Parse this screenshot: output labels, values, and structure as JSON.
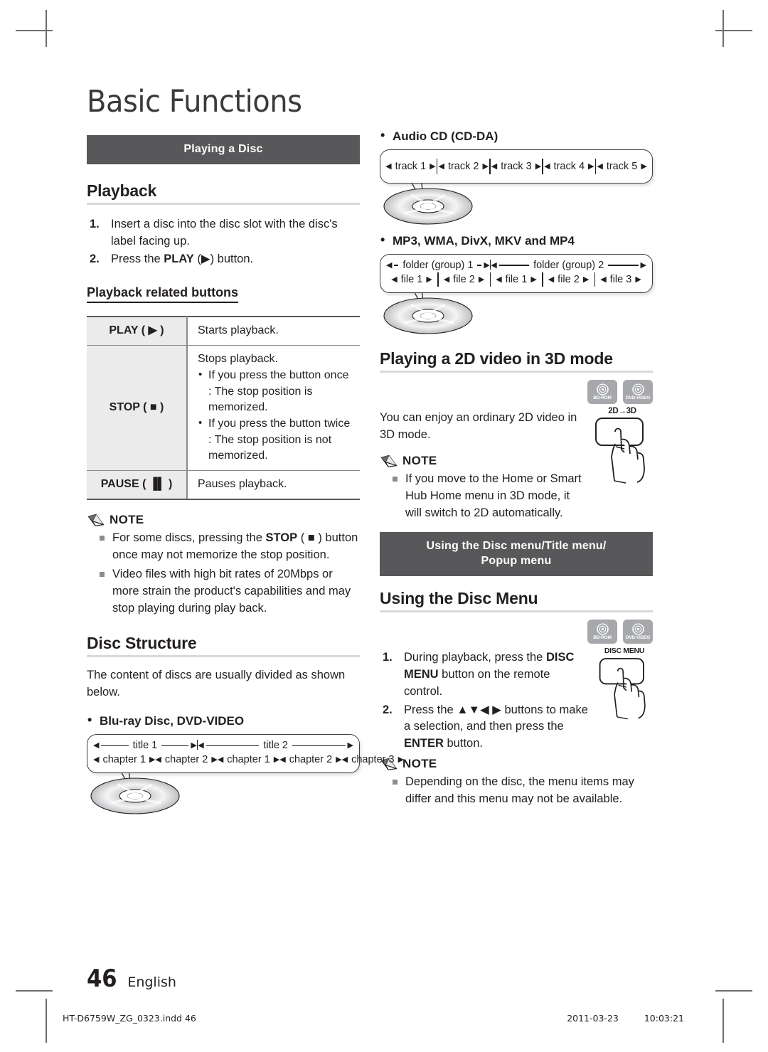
{
  "document": {
    "chapter_title": "Basic Functions",
    "page_number": "46",
    "language": "English",
    "footer_file": "HT-D6759W_ZG_0323.indd   46",
    "footer_date": "2011-03-23",
    "footer_time": "10:03:21"
  },
  "colors": {
    "band_bg": "#58585a",
    "rule": "#d9d9dc",
    "table_key_bg": "#ebebec",
    "badge_bg": "#a6a8ab",
    "text": "#231f20"
  },
  "left": {
    "band_playing_a_disc": "Playing a Disc",
    "playback_heading": "Playback",
    "playback_steps": [
      {
        "num": "1.",
        "text_before": "Insert a disc into the disc slot with the disc's label facing up."
      },
      {
        "num": "2.",
        "text_before": "Press the ",
        "bold": "PLAY",
        "text_after": " (▶) button."
      }
    ],
    "related_buttons_heading": "Playback related buttons",
    "table": {
      "rows": [
        {
          "key": "PLAY",
          "key_symbol": "▶",
          "desc": "Starts playback."
        },
        {
          "key": "STOP",
          "key_symbol": "■",
          "desc": "Stops playback.",
          "bullets": [
            "If you press the button once : The stop position is memorized.",
            "If you press the button twice : The stop position is not memorized."
          ]
        },
        {
          "key": "PAUSE",
          "key_symbol": "▐▌",
          "desc": "Pauses playback."
        }
      ]
    },
    "note_label": "NOTE",
    "notes": [
      {
        "before": "For some discs, pressing the ",
        "bold": "STOP",
        "after": " ( ■ ) button once may not memorize the stop position."
      },
      {
        "before": "Video files with high bit rates of 20Mbps or more strain the product's capabilities and may stop playing during play back.",
        "bold": "",
        "after": ""
      }
    ],
    "disc_structure_heading": "Disc Structure",
    "disc_structure_body": "The content of discs are usually divided as shown below.",
    "bullet_bluray": "Blu-ray Disc, DVD-VIDEO"
  },
  "right": {
    "bullet_audiocd": "Audio CD (CD-DA)",
    "bullet_mp3": "MP3, WMA, DivX, MKV and MP4",
    "heading_2d3d": "Playing a 2D video in 3D mode",
    "body_2d3d": "You can enjoy an ordinary 2D video in 3D mode.",
    "note_label": "NOTE",
    "notes_2d3d": [
      "If you move to the Home or Smart Hub Home menu in 3D mode, it will switch to 2D automatically."
    ],
    "band_disc_menu": "Using the Disc menu/Title menu/ Popup menu",
    "band_disc_menu_line1": "Using the Disc menu/Title menu/",
    "band_disc_menu_line2": "Popup menu",
    "heading_disc_menu": "Using the Disc Menu",
    "disc_menu_steps": [
      {
        "num": "1.",
        "before": "During playback, press the ",
        "bold": "DISC MENU",
        "after": " button on the remote control."
      },
      {
        "num": "2.",
        "before": "Press the ▲▼◀ ▶ buttons to make a selection, and then press the ",
        "bold": "ENTER",
        "after": " button."
      }
    ],
    "note_label2": "NOTE",
    "notes_disc_menu": [
      "Depending on the disc, the menu items may differ and this menu may not be available."
    ],
    "badges": [
      {
        "label": "BD-ROM"
      },
      {
        "label": "DVD-VIDEO"
      }
    ],
    "keyart_2d3d_label": "2D→3D",
    "keyart_discmenu_label": "DISC MENU"
  },
  "diagrams": {
    "bluray": {
      "titles": [
        "title 1",
        "title 2"
      ],
      "chapters": [
        "chapter 1",
        "chapter 2",
        "chapter 1",
        "chapter 2",
        "chapter 3"
      ]
    },
    "audiocd": {
      "tracks": [
        "track 1",
        "track 2",
        "track 3",
        "track 4",
        "track 5"
      ]
    },
    "mp3": {
      "folders": [
        "folder (group) 1",
        "folder (group) 2"
      ],
      "files": [
        "file 1",
        "file 2",
        "file 1",
        "file 2",
        "file 3"
      ]
    }
  }
}
